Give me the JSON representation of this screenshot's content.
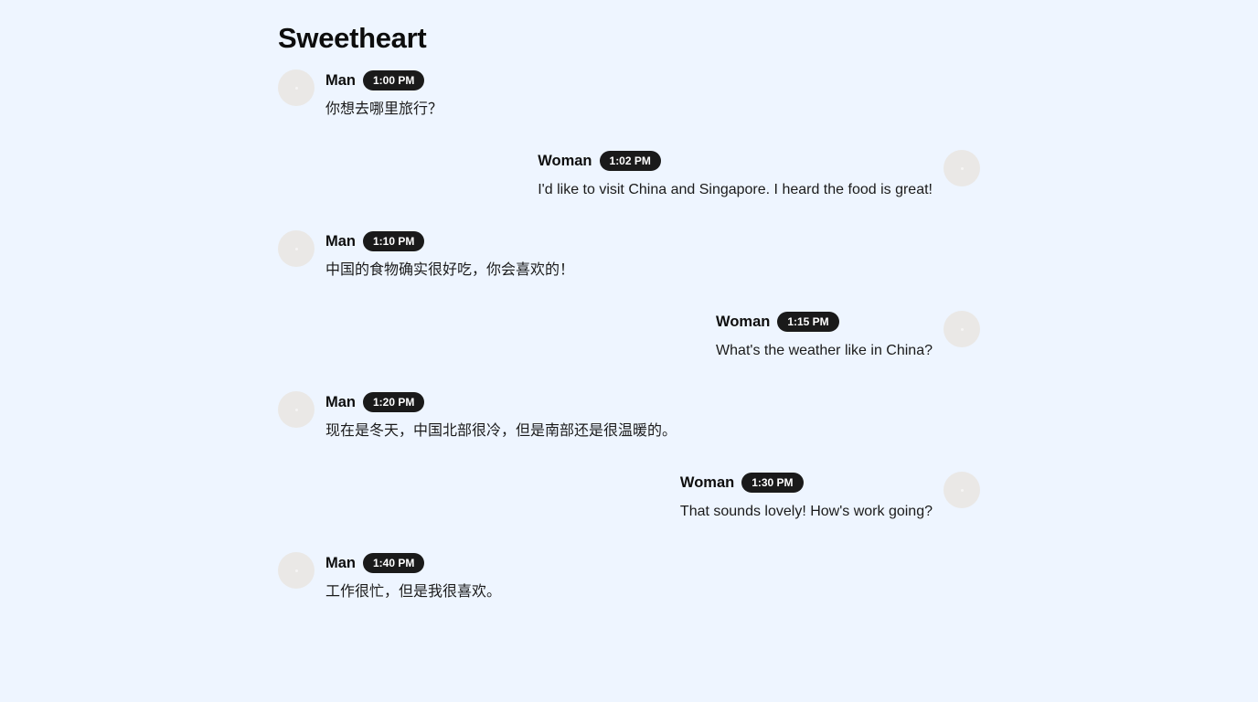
{
  "title": "Sweetheart",
  "messages": [
    {
      "sender": "Man",
      "time": "1:00 PM",
      "text": "你想去哪里旅行？"
    },
    {
      "sender": "Woman",
      "time": "1:02 PM",
      "text": "I'd like to visit China and Singapore. I heard the food is great!"
    },
    {
      "sender": "Man",
      "time": "1:10 PM",
      "text": "中国的食物确实很好吃，你会喜欢的！"
    },
    {
      "sender": "Woman",
      "time": "1:15 PM",
      "text": "What's the weather like in China?"
    },
    {
      "sender": "Man",
      "time": "1:20 PM",
      "text": "现在是冬天，中国北部很冷，但是南部还是很温暖的。"
    },
    {
      "sender": "Woman",
      "time": "1:30 PM",
      "text": "That sounds lovely! How's work going?"
    },
    {
      "sender": "Man",
      "time": "1:40 PM",
      "text": "工作很忙，但是我很喜欢。"
    }
  ],
  "colors": {
    "background": "#eef5ff",
    "time_badge": "#1a1a1a",
    "avatar": "#eae8e6"
  },
  "icons": {
    "avatar": "avatar-icon"
  }
}
